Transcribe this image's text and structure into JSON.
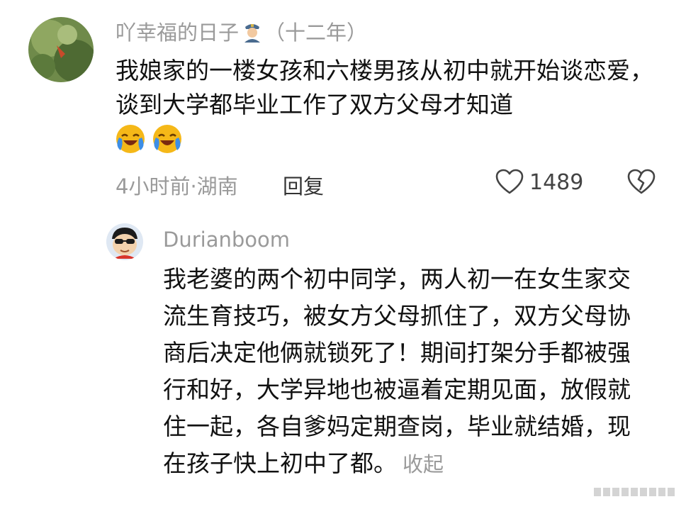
{
  "comment": {
    "username": "吖幸福的日子",
    "user_tag": "（十二年）",
    "text": "我娘家的一楼女孩和六楼男孩从初中就开始谈恋爱，谈到大学都毕业工作了双方父母才知道",
    "time": "4小时前",
    "separator": "·",
    "location": "湖南",
    "reply_label": "回复",
    "likes": "1489",
    "emoji_icon": "laughing-crying-emoji",
    "like_icon": "heart-outline-icon",
    "dislike_icon": "broken-heart-icon"
  },
  "reply": {
    "username": "Durianboom",
    "text": "我老婆的两个初中同学，两人初一在女生家交流生育技巧，被女方父母抓住了，双方父母协商后决定他俩就锁死了！期间打架分手都被强行和好，大学异地也被逼着定期见面，放假就住一起，各自爹妈定期查岗，毕业就结婚，现在孩子快上初中了都。",
    "collapse_label": "收起"
  },
  "colors": {
    "meta_gray": "#9a9a9a",
    "text": "#111111",
    "emoji_yellow": "#f5b818",
    "emoji_blue": "#3d8ee6"
  }
}
